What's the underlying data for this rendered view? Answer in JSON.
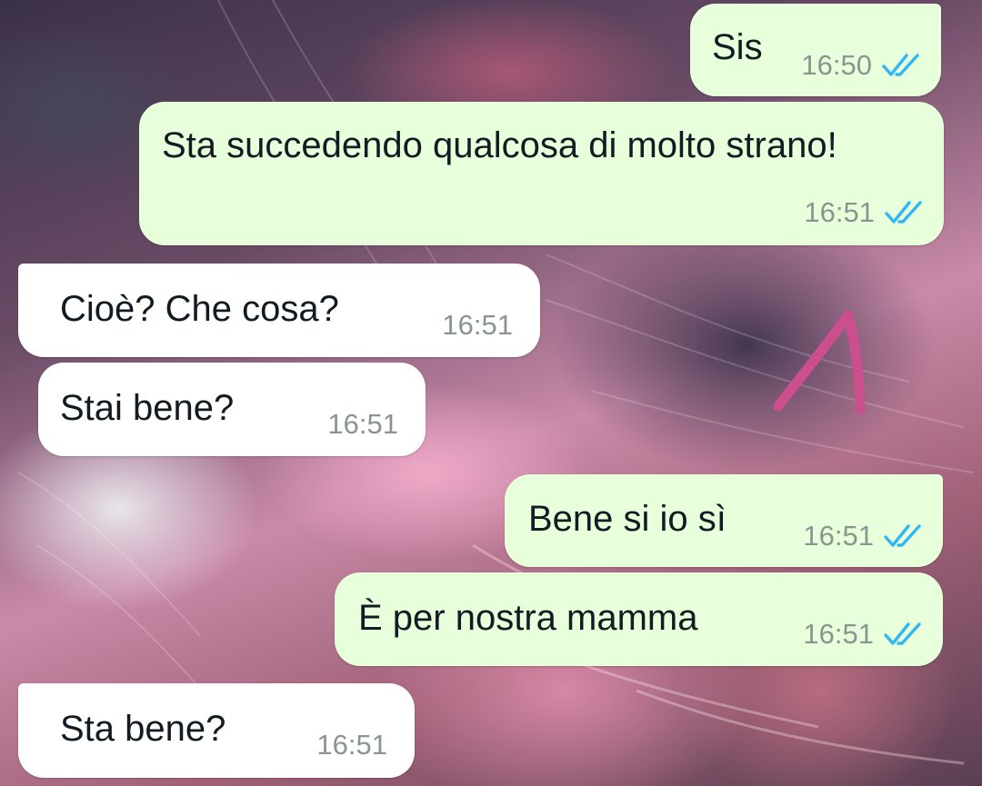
{
  "theme": {
    "outgoing_bubble": "#e7ffdb",
    "incoming_bubble": "#ffffff",
    "tick_color": "#34b7f1",
    "annotation_color": "#cc4f8d"
  },
  "messages": [
    {
      "direction": "out",
      "text": "Sis",
      "time": "16:50",
      "status": "read",
      "status_icon": "double-check-icon"
    },
    {
      "direction": "out",
      "text": "Sta succedendo qualcosa di molto strano!",
      "time": "16:51",
      "status": "read",
      "status_icon": "double-check-icon"
    },
    {
      "direction": "in",
      "text": "Cioè? Che cosa?",
      "time": "16:51"
    },
    {
      "direction": "in",
      "text": "Stai bene?",
      "time": "16:51"
    },
    {
      "direction": "out",
      "text": "Bene si io sì",
      "time": "16:51",
      "status": "read",
      "status_icon": "double-check-icon"
    },
    {
      "direction": "out",
      "text": "È per nostra mamma",
      "time": "16:51",
      "status": "read",
      "status_icon": "double-check-icon"
    },
    {
      "direction": "in",
      "text": "Sta bene?",
      "time": "16:51"
    }
  ],
  "annotation": {
    "icon": "hand-drawn-arrow-icon"
  }
}
